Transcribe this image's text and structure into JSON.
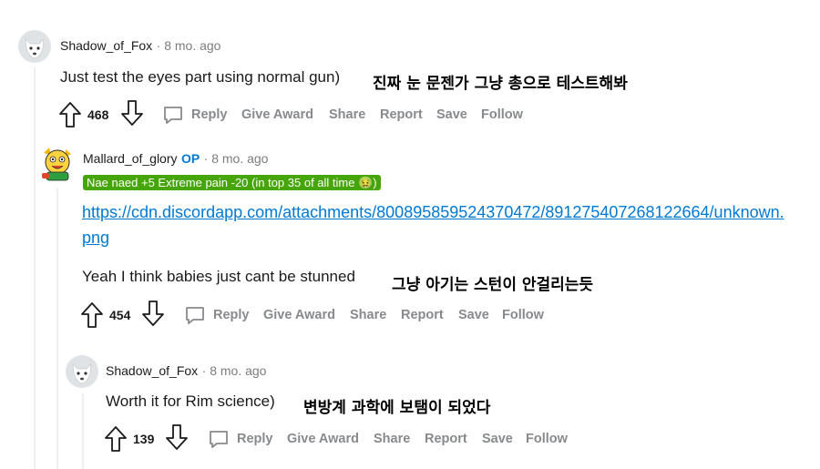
{
  "comments": [
    {
      "author": "Shadow_of_Fox",
      "age": "· 8 mo. ago",
      "body": "Just test the eyes part using normal gun)",
      "annotation": "진짜 눈 문젠가 그냥 총으로 테스트해봐",
      "score": "468",
      "avatar_icon": "wolf-avatar"
    },
    {
      "author": "Mallard_of_glory",
      "op": "OP",
      "age": "· 8 mo. ago",
      "flair": "Nae naed +5 Extreme pain -20 (in top 35 of all time 🤢)",
      "link_line1": "https://cdn.discordapp.com/attachments/800895859524370472/891275407268122664/unknown.",
      "link_line2": "png",
      "body": "Yeah I think babies just cant be stunned",
      "annotation": "그냥 아기는 스턴이 안걸리는듯",
      "score": "454",
      "avatar_icon": "cartoon-avatar"
    },
    {
      "author": "Shadow_of_Fox",
      "age": "· 8 mo. ago",
      "body": "Worth it for Rim science)",
      "annotation": "변방계 과학에 보탬이 되었다",
      "score": "139",
      "avatar_icon": "wolf-avatar"
    }
  ],
  "actions": {
    "reply": "Reply",
    "give_award": "Give Award",
    "share": "Share",
    "report": "Report",
    "save": "Save",
    "follow": "Follow"
  },
  "colors": {
    "flair_bg": "#46a508",
    "link": "#0079d3",
    "op": "#0079d3",
    "action_gray": "#878a8c",
    "thread_line": "#edeff1"
  }
}
